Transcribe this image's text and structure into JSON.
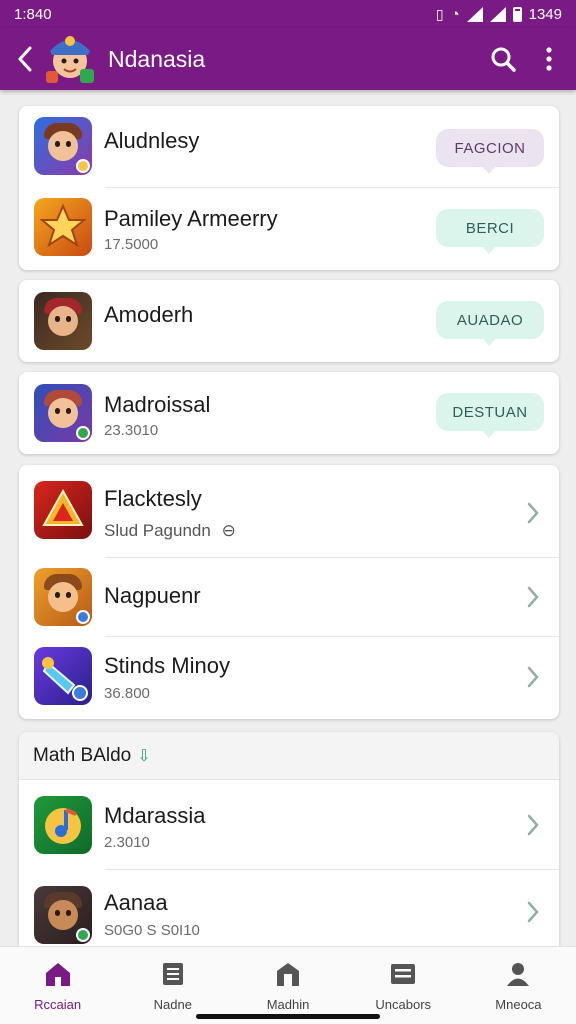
{
  "status": {
    "time": "1:840",
    "right_text": "1349"
  },
  "appbar": {
    "title": "Ndanasia"
  },
  "colors": {
    "primary": "#7a1a84",
    "pill_purple": "#ece3f1",
    "pill_mint": "#dcf5ec",
    "accent_green": "#2fa84f"
  },
  "card1": {
    "rows": [
      {
        "title": "Aludnlesy",
        "subtitle": "",
        "pill": "FAGCION",
        "icon": "hero-avatar-icon"
      },
      {
        "title": "Pamiley Armeerry",
        "subtitle": "17.5000",
        "pill": "BERCI",
        "icon": "star-emblem-icon"
      }
    ]
  },
  "card2": {
    "title": "Amoderh",
    "pill": "AUADAO",
    "icon": "warrior-avatar-icon"
  },
  "card3": {
    "title": "Madroissal",
    "subtitle": "23.3010",
    "pill": "DESTUAN",
    "icon": "wizard-avatar-icon"
  },
  "card4": {
    "rows": [
      {
        "title": "Flacktesly",
        "subtitle": "Slud Pagundn",
        "icon": "triangle-emblem-icon"
      },
      {
        "title": "Nagpuenr",
        "subtitle": "",
        "icon": "bear-avatar-icon"
      },
      {
        "title": "Stinds Minoy",
        "subtitle": "36.800",
        "icon": "crystal-icon"
      }
    ]
  },
  "section": {
    "header": "Math BAldo",
    "rows": [
      {
        "title": "Mdarassia",
        "subtitle": "2.3010",
        "icon": "music-note-icon"
      },
      {
        "title": "Aanaa",
        "subtitle": "S0G0 S S0I10",
        "icon": "monkey-avatar-icon"
      }
    ]
  },
  "nav": {
    "items": [
      {
        "label": "Rccaian",
        "icon": "home-icon",
        "active": true
      },
      {
        "label": "Nadne",
        "icon": "list-icon",
        "active": false
      },
      {
        "label": "Madhin",
        "icon": "store-icon",
        "active": false
      },
      {
        "label": "Uncabors",
        "icon": "inbox-icon",
        "active": false
      },
      {
        "label": "Mneoca",
        "icon": "profile-icon",
        "active": false
      }
    ]
  }
}
